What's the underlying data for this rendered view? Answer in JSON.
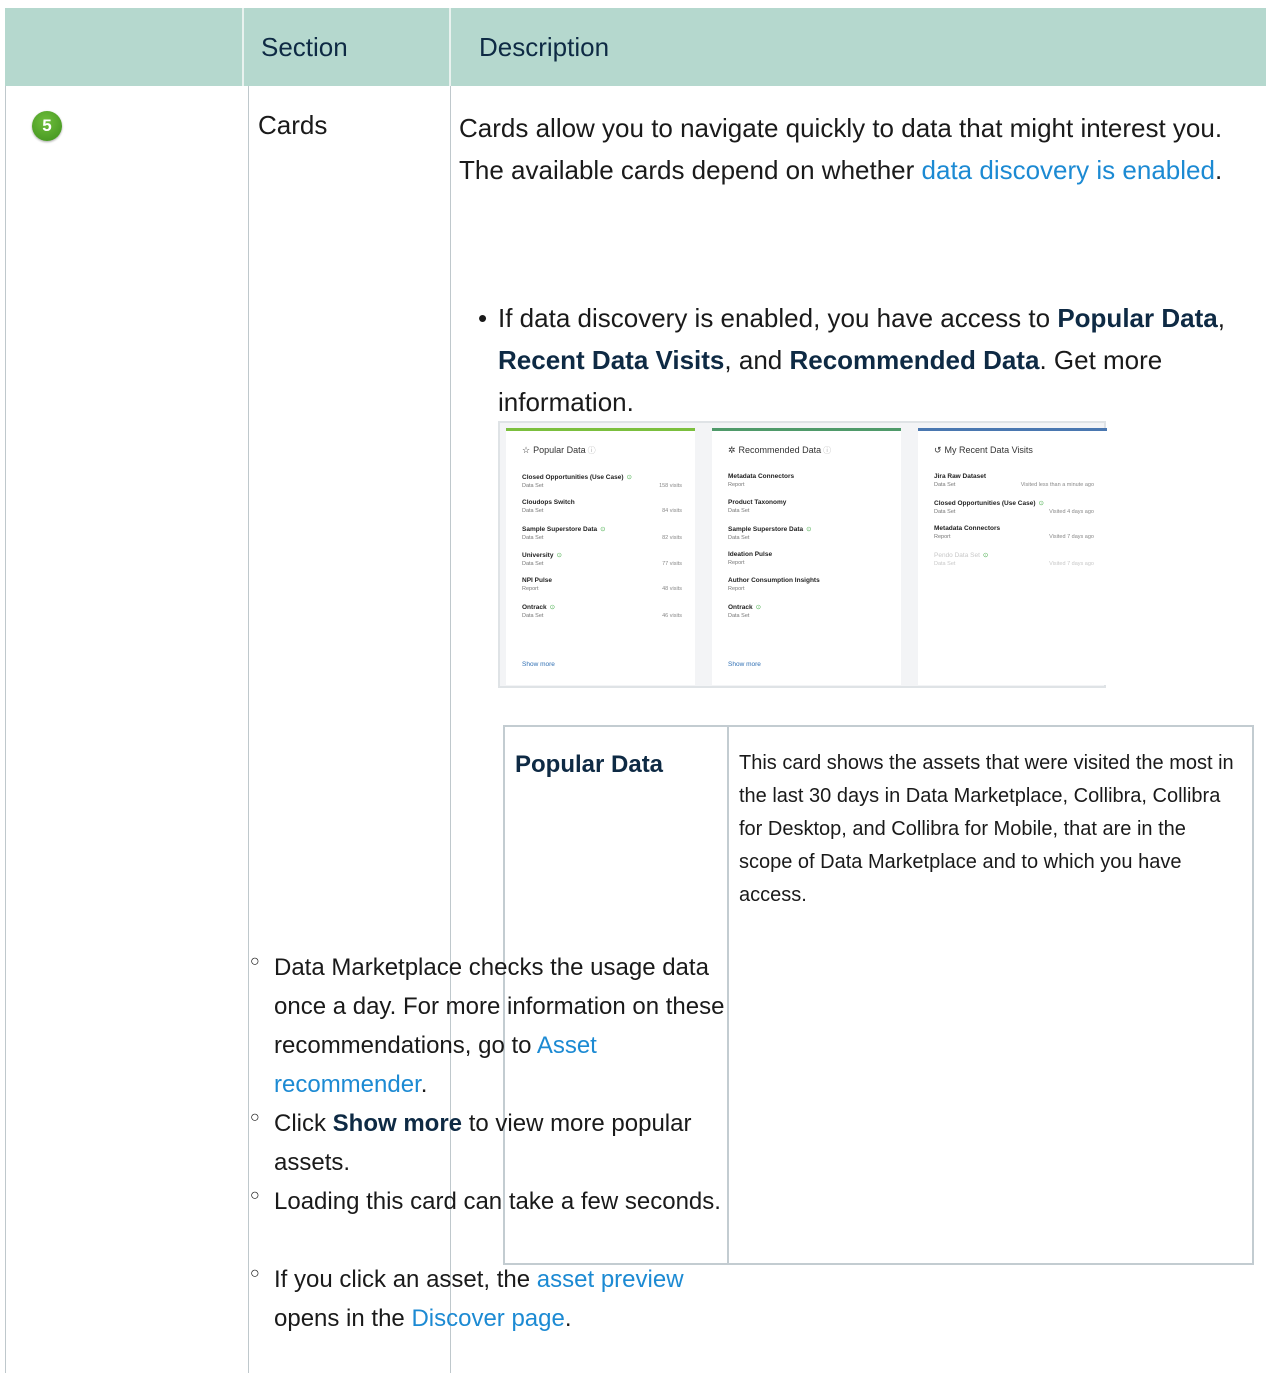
{
  "header": {
    "col_section": "Section",
    "col_description": "Description"
  },
  "row": {
    "badge": "5",
    "section": "Cards",
    "intro_line1": "Cards allow you to navigate quickly to data that might interest you.",
    "intro_line2_prefix": "The available cards depend on whether ",
    "intro_link": "data discovery is enabled",
    "intro_line2_suffix": ".",
    "bullet_prefix": "If data discovery is enabled, you have access to ",
    "bullet_b1": "Popular Data",
    "bullet_sep1": ", ",
    "bullet_b2": "Recent Data Visits",
    "bullet_sep2": ", and ",
    "bullet_b3": "Recommended Data",
    "bullet_suffix": ". Get more information."
  },
  "cards": [
    {
      "title": "Popular Data",
      "icon": "star-icon",
      "bar_color": "#7bbf3e",
      "items": [
        {
          "name": "Closed Opportunities (Use Case)",
          "type": "Data Set",
          "meta": "158 visits",
          "certified": true
        },
        {
          "name": "Cloudops Switch",
          "type": "Data Set",
          "meta": "84 visits",
          "certified": false
        },
        {
          "name": "Sample Superstore Data",
          "type": "Data Set",
          "meta": "82 visits",
          "certified": true
        },
        {
          "name": "University",
          "type": "Data Set",
          "meta": "77 visits",
          "certified": true
        },
        {
          "name": "NPI Pulse",
          "type": "Report",
          "meta": "48 visits",
          "certified": false
        },
        {
          "name": "Ontrack",
          "type": "Data Set",
          "meta": "46 visits",
          "certified": true
        }
      ],
      "show_more": "Show more"
    },
    {
      "title": "Recommended Data",
      "icon": "lightbulb-icon",
      "bar_color": "#4f9a6a",
      "items": [
        {
          "name": "Metadata Connectors",
          "type": "Report",
          "meta": "",
          "certified": false
        },
        {
          "name": "Product Taxonomy",
          "type": "Data Set",
          "meta": "",
          "certified": false
        },
        {
          "name": "Sample Superstore Data",
          "type": "Data Set",
          "meta": "",
          "certified": true
        },
        {
          "name": "Ideation Pulse",
          "type": "Report",
          "meta": "",
          "certified": false
        },
        {
          "name": "Author Consumption Insights",
          "type": "Report",
          "meta": "",
          "certified": false
        },
        {
          "name": "Ontrack",
          "type": "Data Set",
          "meta": "",
          "certified": true
        }
      ],
      "show_more": "Show more"
    },
    {
      "title": "My Recent Data Visits",
      "icon": "history-icon",
      "bar_color": "#4a77b0",
      "items": [
        {
          "name": "Jira Raw Dataset",
          "type": "Data Set",
          "meta": "Visited less than a minute ago",
          "certified": false
        },
        {
          "name": "Closed Opportunities (Use Case)",
          "type": "Data Set",
          "meta": "Visited 4 days ago",
          "certified": true
        },
        {
          "name": "Metadata Connectors",
          "type": "Report",
          "meta": "Visited 7 days ago",
          "certified": false
        },
        {
          "name": "Pendo Data Set",
          "type": "Data Set",
          "meta": "Visited 7 days ago",
          "certified": true,
          "dim": true
        }
      ],
      "show_more": ""
    }
  ],
  "inner_table": {
    "term": "Popular Data",
    "definition": "This card shows the assets that were visited the most in the last 30 days in Data Marketplace, Collibra, Collibra for Desktop, and Collibra for Mobile, that are in the scope of Data Marketplace and to which you have access.",
    "sub1_prefix": "Data Marketplace checks the usage data once a day. For more information on these recommendations, go to ",
    "sub1_link": "Asset recommender",
    "sub1_suffix": ".",
    "sub2_prefix": "Click ",
    "sub2_bold": "Show more",
    "sub2_suffix": " to view more popular assets.",
    "sub3": "Loading this card can take a few seconds.",
    "sub4_prefix": "If you click an asset, the ",
    "sub4_link1": "asset preview",
    "sub4_middle": " opens in the ",
    "sub4_link2": "Discover page",
    "sub4_suffix": "."
  }
}
